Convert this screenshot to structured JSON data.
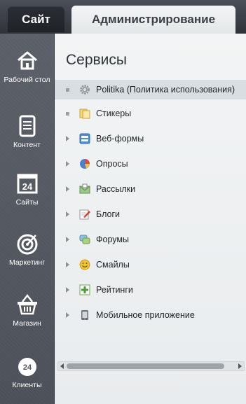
{
  "tabs": {
    "site": "Сайт",
    "admin": "Администрирование"
  },
  "sidebar": {
    "items": [
      {
        "label": "Рабочий стол",
        "icon": "home-icon"
      },
      {
        "label": "Контент",
        "icon": "document-icon"
      },
      {
        "label": "Сайты",
        "icon": "calendar-24-icon",
        "icon_text": "24"
      },
      {
        "label": "Маркетинг",
        "icon": "target-icon"
      },
      {
        "label": "Магазин",
        "icon": "basket-icon"
      },
      {
        "label": "Клиенты",
        "icon": "clients-24-icon",
        "icon_text": "24"
      }
    ]
  },
  "main": {
    "title": "Сервисы",
    "items": [
      {
        "label": "Politika (Политика использования)",
        "icon": "gear-icon",
        "marker": "bullet",
        "selected": true
      },
      {
        "label": "Стикеры",
        "icon": "sticker-icon",
        "marker": "bullet"
      },
      {
        "label": "Веб-формы",
        "icon": "webform-icon",
        "marker": "arrow"
      },
      {
        "label": "Опросы",
        "icon": "poll-pie-icon",
        "marker": "arrow"
      },
      {
        "label": "Рассылки",
        "icon": "mail-icon",
        "marker": "arrow"
      },
      {
        "label": "Блоги",
        "icon": "blog-icon",
        "marker": "arrow"
      },
      {
        "label": "Форумы",
        "icon": "forum-icon",
        "marker": "arrow"
      },
      {
        "label": "Смайлы",
        "icon": "smiley-icon",
        "marker": "arrow"
      },
      {
        "label": "Рейтинги",
        "icon": "rating-icon",
        "marker": "arrow"
      },
      {
        "label": "Мобильное приложение",
        "icon": "mobile-icon",
        "marker": "arrow"
      }
    ]
  },
  "colors": {
    "sidebar": "#50545c",
    "panel": "#eef0f2",
    "selected_row": "#d9dee2"
  }
}
